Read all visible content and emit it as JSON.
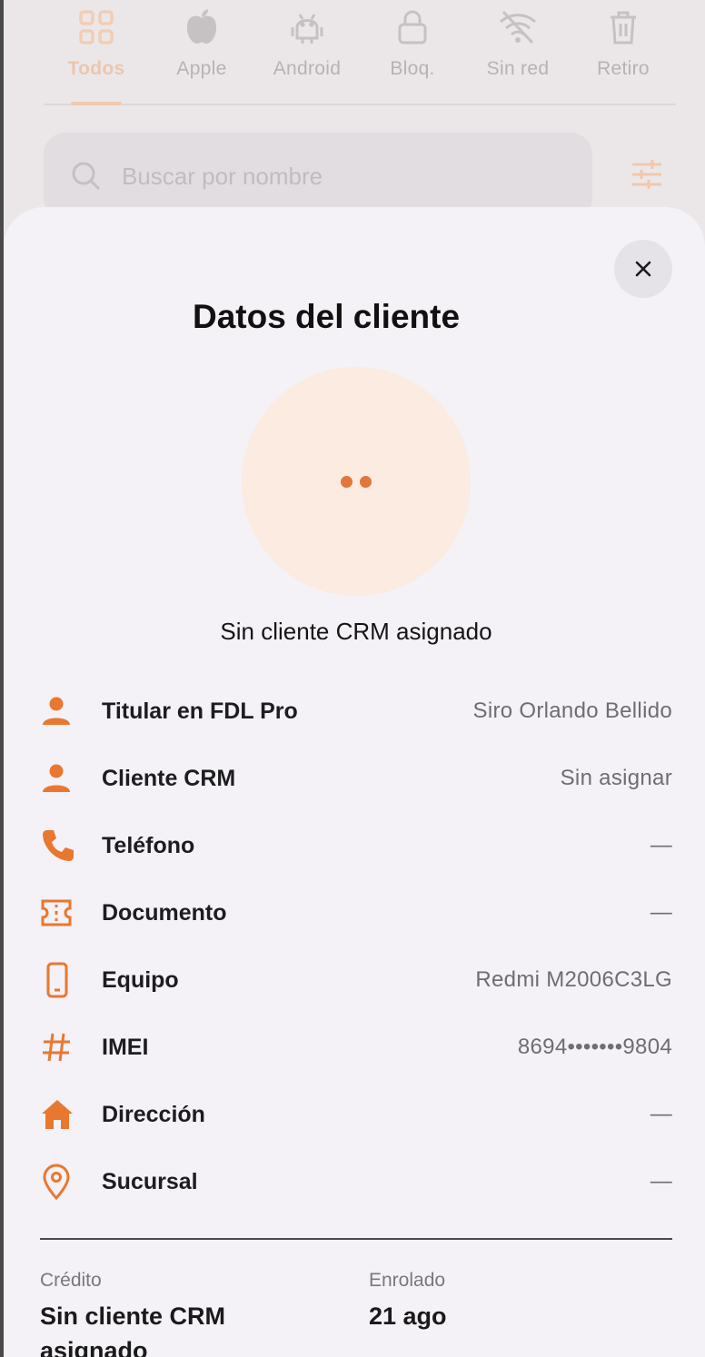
{
  "background": {
    "tabs": [
      {
        "label": "Todos",
        "icon": "grid-icon",
        "active": true
      },
      {
        "label": "Apple",
        "icon": "apple-icon",
        "active": false
      },
      {
        "label": "Android",
        "icon": "android-icon",
        "active": false
      },
      {
        "label": "Bloq.",
        "icon": "lock-icon",
        "active": false
      },
      {
        "label": "Sin red",
        "icon": "wifi-off-icon",
        "active": false
      },
      {
        "label": "Retiro",
        "icon": "trash-icon",
        "active": false
      }
    ],
    "search": {
      "placeholder": "Buscar por nombre"
    }
  },
  "sheet": {
    "title": "Datos del cliente",
    "subtitle": "Sin cliente CRM asignado",
    "rows": [
      {
        "label": "Titular en FDL Pro",
        "value": "Siro Orlando Bellido",
        "icon": "person-icon"
      },
      {
        "label": "Cliente CRM",
        "value": "Sin asignar",
        "icon": "person-icon"
      },
      {
        "label": "Teléfono",
        "value": "—",
        "icon": "phone-icon"
      },
      {
        "label": "Documento",
        "value": "—",
        "icon": "ticket-icon"
      },
      {
        "label": "Equipo",
        "value": "Redmi M2006C3LG",
        "icon": "smartphone-icon"
      },
      {
        "label": "IMEI",
        "value": "8694•••••••9804",
        "icon": "hash-icon"
      },
      {
        "label": "Dirección",
        "value": "—",
        "icon": "home-icon"
      },
      {
        "label": "Sucursal",
        "value": "—",
        "icon": "location-pin-icon"
      }
    ],
    "footer": {
      "credito_label": "Crédito",
      "credito_value_line1": "Sin cliente CRM",
      "credito_value_line2": "asignado",
      "enrolado_label": "Enrolado",
      "enrolado_value": "21 ago"
    }
  },
  "colors": {
    "accent": "#e8782f",
    "avatar_bg": "#fbebe0",
    "sheet_bg": "#f4f1f7"
  }
}
